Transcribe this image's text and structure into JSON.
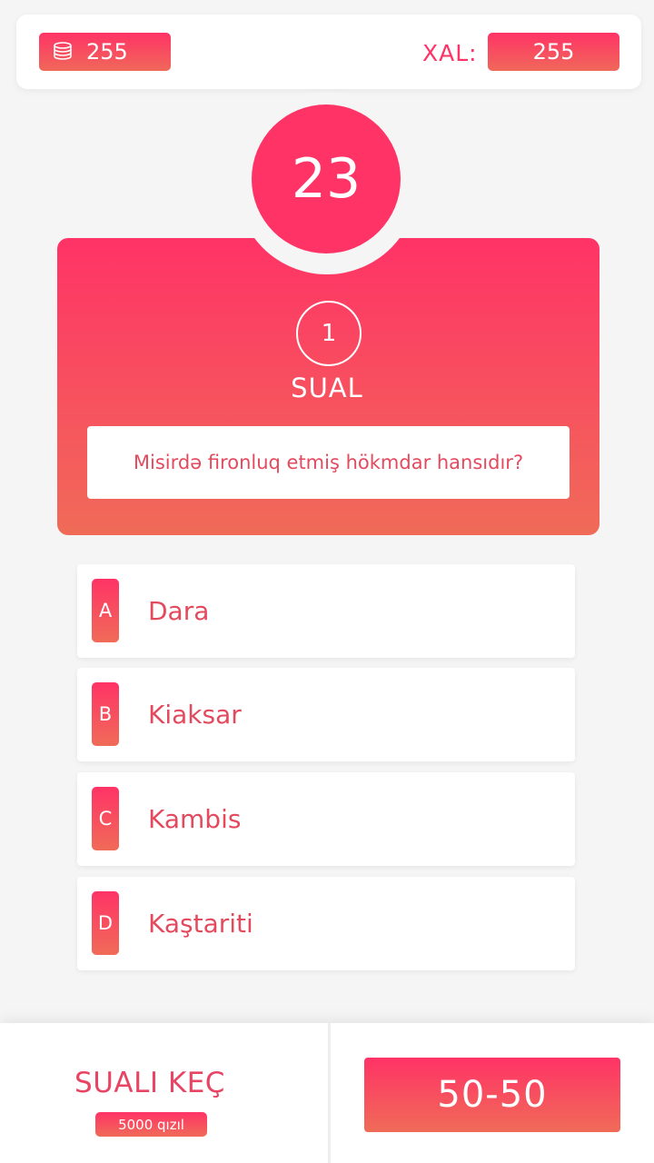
{
  "header": {
    "coins": "255",
    "score_label": "XAL:",
    "score": "255"
  },
  "timer": {
    "seconds": "23"
  },
  "question": {
    "number": "1",
    "label": "SUAL",
    "text": "Misirdə fironluq etmiş hökmdar hansıdır?"
  },
  "answers": [
    {
      "letter": "A",
      "text": "Dara"
    },
    {
      "letter": "B",
      "text": "Kiaksar"
    },
    {
      "letter": "C",
      "text": "Kambis"
    },
    {
      "letter": "D",
      "text": "Kaştariti"
    }
  ],
  "footer": {
    "skip_label": "SUALI KEÇ",
    "skip_price": "5000 qızıl",
    "fifty_label": "50-50"
  },
  "colors": {
    "accent": "#ff3366",
    "accent_end": "#f06b58",
    "text_accent": "#e34a5e"
  },
  "icons": {
    "coins": "coins-icon"
  }
}
